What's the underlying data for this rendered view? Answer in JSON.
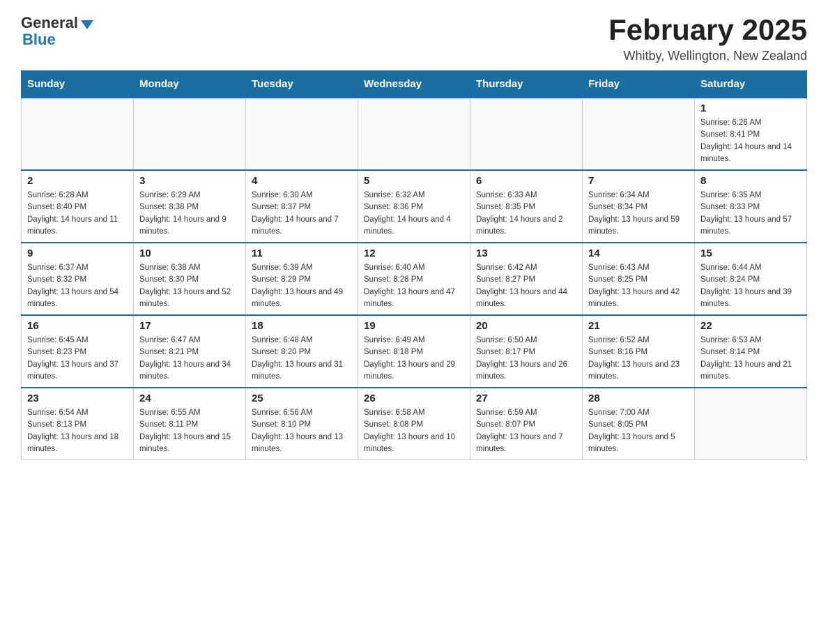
{
  "header": {
    "logo_general": "General",
    "logo_blue": "Blue",
    "title": "February 2025",
    "subtitle": "Whitby, Wellington, New Zealand"
  },
  "days_of_week": [
    "Sunday",
    "Monday",
    "Tuesday",
    "Wednesday",
    "Thursday",
    "Friday",
    "Saturday"
  ],
  "weeks": [
    {
      "days": [
        {
          "number": "",
          "info": ""
        },
        {
          "number": "",
          "info": ""
        },
        {
          "number": "",
          "info": ""
        },
        {
          "number": "",
          "info": ""
        },
        {
          "number": "",
          "info": ""
        },
        {
          "number": "",
          "info": ""
        },
        {
          "number": "1",
          "info": "Sunrise: 6:26 AM\nSunset: 8:41 PM\nDaylight: 14 hours and 14 minutes."
        }
      ]
    },
    {
      "days": [
        {
          "number": "2",
          "info": "Sunrise: 6:28 AM\nSunset: 8:40 PM\nDaylight: 14 hours and 11 minutes."
        },
        {
          "number": "3",
          "info": "Sunrise: 6:29 AM\nSunset: 8:38 PM\nDaylight: 14 hours and 9 minutes."
        },
        {
          "number": "4",
          "info": "Sunrise: 6:30 AM\nSunset: 8:37 PM\nDaylight: 14 hours and 7 minutes."
        },
        {
          "number": "5",
          "info": "Sunrise: 6:32 AM\nSunset: 8:36 PM\nDaylight: 14 hours and 4 minutes."
        },
        {
          "number": "6",
          "info": "Sunrise: 6:33 AM\nSunset: 8:35 PM\nDaylight: 14 hours and 2 minutes."
        },
        {
          "number": "7",
          "info": "Sunrise: 6:34 AM\nSunset: 8:34 PM\nDaylight: 13 hours and 59 minutes."
        },
        {
          "number": "8",
          "info": "Sunrise: 6:35 AM\nSunset: 8:33 PM\nDaylight: 13 hours and 57 minutes."
        }
      ]
    },
    {
      "days": [
        {
          "number": "9",
          "info": "Sunrise: 6:37 AM\nSunset: 8:32 PM\nDaylight: 13 hours and 54 minutes."
        },
        {
          "number": "10",
          "info": "Sunrise: 6:38 AM\nSunset: 8:30 PM\nDaylight: 13 hours and 52 minutes."
        },
        {
          "number": "11",
          "info": "Sunrise: 6:39 AM\nSunset: 8:29 PM\nDaylight: 13 hours and 49 minutes."
        },
        {
          "number": "12",
          "info": "Sunrise: 6:40 AM\nSunset: 8:28 PM\nDaylight: 13 hours and 47 minutes."
        },
        {
          "number": "13",
          "info": "Sunrise: 6:42 AM\nSunset: 8:27 PM\nDaylight: 13 hours and 44 minutes."
        },
        {
          "number": "14",
          "info": "Sunrise: 6:43 AM\nSunset: 8:25 PM\nDaylight: 13 hours and 42 minutes."
        },
        {
          "number": "15",
          "info": "Sunrise: 6:44 AM\nSunset: 8:24 PM\nDaylight: 13 hours and 39 minutes."
        }
      ]
    },
    {
      "days": [
        {
          "number": "16",
          "info": "Sunrise: 6:45 AM\nSunset: 8:23 PM\nDaylight: 13 hours and 37 minutes."
        },
        {
          "number": "17",
          "info": "Sunrise: 6:47 AM\nSunset: 8:21 PM\nDaylight: 13 hours and 34 minutes."
        },
        {
          "number": "18",
          "info": "Sunrise: 6:48 AM\nSunset: 8:20 PM\nDaylight: 13 hours and 31 minutes."
        },
        {
          "number": "19",
          "info": "Sunrise: 6:49 AM\nSunset: 8:18 PM\nDaylight: 13 hours and 29 minutes."
        },
        {
          "number": "20",
          "info": "Sunrise: 6:50 AM\nSunset: 8:17 PM\nDaylight: 13 hours and 26 minutes."
        },
        {
          "number": "21",
          "info": "Sunrise: 6:52 AM\nSunset: 8:16 PM\nDaylight: 13 hours and 23 minutes."
        },
        {
          "number": "22",
          "info": "Sunrise: 6:53 AM\nSunset: 8:14 PM\nDaylight: 13 hours and 21 minutes."
        }
      ]
    },
    {
      "days": [
        {
          "number": "23",
          "info": "Sunrise: 6:54 AM\nSunset: 8:13 PM\nDaylight: 13 hours and 18 minutes."
        },
        {
          "number": "24",
          "info": "Sunrise: 6:55 AM\nSunset: 8:11 PM\nDaylight: 13 hours and 15 minutes."
        },
        {
          "number": "25",
          "info": "Sunrise: 6:56 AM\nSunset: 8:10 PM\nDaylight: 13 hours and 13 minutes."
        },
        {
          "number": "26",
          "info": "Sunrise: 6:58 AM\nSunset: 8:08 PM\nDaylight: 13 hours and 10 minutes."
        },
        {
          "number": "27",
          "info": "Sunrise: 6:59 AM\nSunset: 8:07 PM\nDaylight: 13 hours and 7 minutes."
        },
        {
          "number": "28",
          "info": "Sunrise: 7:00 AM\nSunset: 8:05 PM\nDaylight: 13 hours and 5 minutes."
        },
        {
          "number": "",
          "info": ""
        }
      ]
    }
  ]
}
